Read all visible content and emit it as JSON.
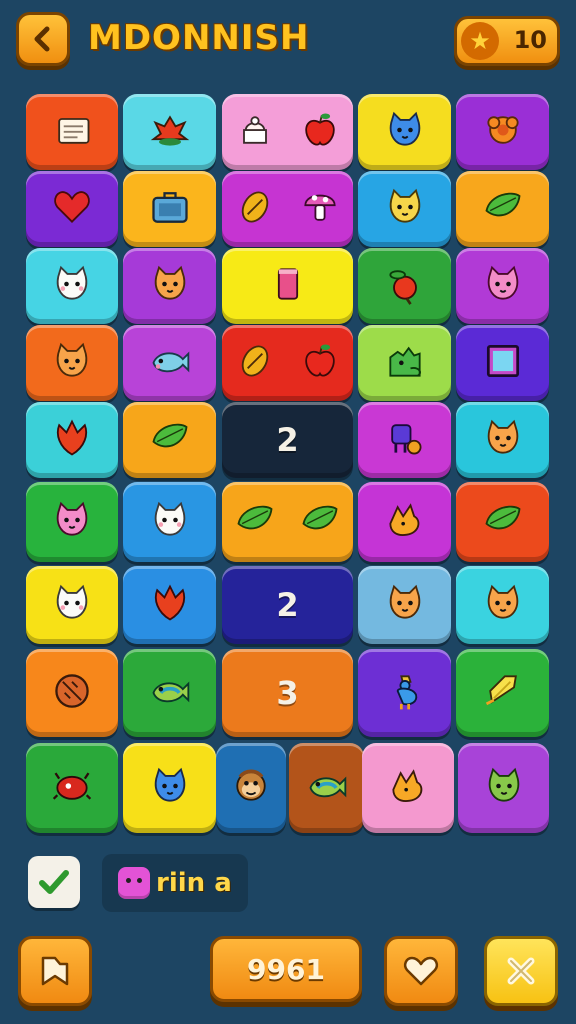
{
  "header": {
    "back_icon": "chevron-left-icon",
    "title": "MDONNISH",
    "star_icon": "star-icon",
    "star_count": "10"
  },
  "board": {
    "tiles": [
      {
        "name": "tile-flag",
        "color": "#f0511c",
        "icons": [
          "flag"
        ]
      },
      {
        "name": "tile-flower",
        "color": "#5ad8e6",
        "icons": [
          "flower"
        ]
      },
      {
        "name": "tile-cake-apple",
        "color": "#f49ed8",
        "icons": [
          "cake",
          "apple"
        ]
      },
      {
        "name": "tile-cat-blue",
        "color": "#f5dd1f",
        "icons": [
          "cat-blue"
        ]
      },
      {
        "name": "tile-orange-flower",
        "color": "#9a2fd6",
        "icons": [
          "orange-flower"
        ]
      },
      {
        "name": "tile-heart",
        "color": "#7b2ad4",
        "icons": [
          "heart"
        ]
      },
      {
        "name": "tile-briefcase",
        "color": "#fbb51c",
        "icons": [
          "briefcase"
        ]
      },
      {
        "name": "tile-seed-mushroom",
        "color": "#c634d2",
        "icons": [
          "seed",
          "mushroom"
        ]
      },
      {
        "name": "tile-cat-yellow",
        "color": "#27a5e4",
        "icons": [
          "cat-yellow"
        ]
      },
      {
        "name": "tile-leaf",
        "color": "#f8a71c",
        "icons": [
          "leaf-green"
        ]
      },
      {
        "name": "tile-cat-white",
        "color": "#46d4e4",
        "icons": [
          "cat-white"
        ]
      },
      {
        "name": "tile-cat-orange",
        "color": "#a63ad8",
        "icons": [
          "cat-orange"
        ]
      },
      {
        "name": "tile-cup",
        "color": "#f7ea16",
        "icons": [
          "cup"
        ]
      },
      {
        "name": "tile-apple",
        "color": "#2fa53a",
        "icons": [
          "apple-leaf"
        ]
      },
      {
        "name": "tile-cat-pink",
        "color": "#b13ad6",
        "icons": [
          "cat-pink"
        ]
      },
      {
        "name": "tile-cat-orange-2",
        "color": "#f26a1c",
        "icons": [
          "cat-orange"
        ]
      },
      {
        "name": "tile-fish-blue",
        "color": "#b843d8",
        "icons": [
          "fish-blue"
        ]
      },
      {
        "name": "tile-seed-apple",
        "color": "#e52a1e",
        "icons": [
          "seed",
          "apple"
        ]
      },
      {
        "name": "tile-green-dino",
        "color": "#9ddc4a",
        "icons": [
          "dino"
        ]
      },
      {
        "name": "tile-frame",
        "color": "#5b2ad6",
        "icons": [
          "frame"
        ]
      },
      {
        "name": "tile-red-leaf",
        "color": "#3bd0d8",
        "icons": [
          "red-leaf"
        ]
      },
      {
        "name": "tile-green-leaf",
        "color": "#f7a61a",
        "icons": [
          "leaf-green"
        ]
      },
      {
        "name": "tile-number-2-dark",
        "color": "#16263a",
        "num": "2"
      },
      {
        "name": "tile-toy",
        "color": "#c938d4",
        "icons": [
          "toy"
        ]
      },
      {
        "name": "tile-cat-orange-3",
        "color": "#29c6dc",
        "icons": [
          "cat-orange"
        ]
      },
      {
        "name": "tile-cat-pink-2",
        "color": "#28b33d",
        "icons": [
          "cat-pink"
        ]
      },
      {
        "name": "tile-cat-white-2",
        "color": "#2996e3",
        "icons": [
          "cat-white"
        ]
      },
      {
        "name": "tile-two-leaves",
        "color": "#f7a51a",
        "icons": [
          "leaf-green",
          "leaf-green"
        ]
      },
      {
        "name": "tile-bird-orange",
        "color": "#c534d6",
        "icons": [
          "bird"
        ]
      },
      {
        "name": "tile-green-leaf-2",
        "color": "#ec4a1c",
        "icons": [
          "leaf-green"
        ]
      },
      {
        "name": "tile-cat-white-3",
        "color": "#f7e116",
        "icons": [
          "cat-white"
        ]
      },
      {
        "name": "tile-red-leaf-2",
        "color": "#2a8fe3",
        "icons": [
          "red-leaf"
        ]
      },
      {
        "name": "tile-number-2-blue",
        "color": "#25239a",
        "num": "2"
      },
      {
        "name": "tile-cat-orange-4",
        "color": "#74b9e0",
        "icons": [
          "cat-orange"
        ]
      },
      {
        "name": "tile-cat-orange-5",
        "color": "#3ad3e0",
        "icons": [
          "cat-orange"
        ]
      },
      {
        "name": "tile-cookie",
        "color": "#f7871b",
        "icons": [
          "cookie"
        ]
      },
      {
        "name": "tile-fish-green",
        "color": "#2ca93a",
        "icons": [
          "fish-green"
        ]
      },
      {
        "name": "tile-number-3",
        "color": "#ec7a1c",
        "num": "3"
      },
      {
        "name": "tile-rooster",
        "color": "#6d2fd4",
        "icons": [
          "rooster"
        ]
      },
      {
        "name": "tile-paper",
        "color": "#2bb23a",
        "icons": [
          "paper"
        ]
      },
      {
        "name": "tile-red-bug",
        "color": "#2aa93a",
        "icons": [
          "bug"
        ]
      },
      {
        "name": "tile-cat-blue-2",
        "color": "#f7e018",
        "icons": [
          "cat-blue"
        ]
      },
      {
        "name": "tile-monkey",
        "color": "#1f6fb3",
        "icons": [
          "monkey"
        ]
      },
      {
        "name": "tile-fish-green-2",
        "color": "#b3541a",
        "icons": [
          "fish-green"
        ]
      },
      {
        "name": "tile-orange-bird",
        "color": "#f499cf",
        "icons": [
          "bird"
        ]
      },
      {
        "name": "tile-cat-green",
        "color": "#a843d8",
        "icons": [
          "cat-green"
        ]
      }
    ]
  },
  "footer": {
    "check_icon": "checkmark-icon",
    "player_name": "riin a",
    "bookmark_icon": "bookmark-icon",
    "score": "9961",
    "heart_icon": "heart-outline-icon",
    "close_icon": "close-icon"
  }
}
